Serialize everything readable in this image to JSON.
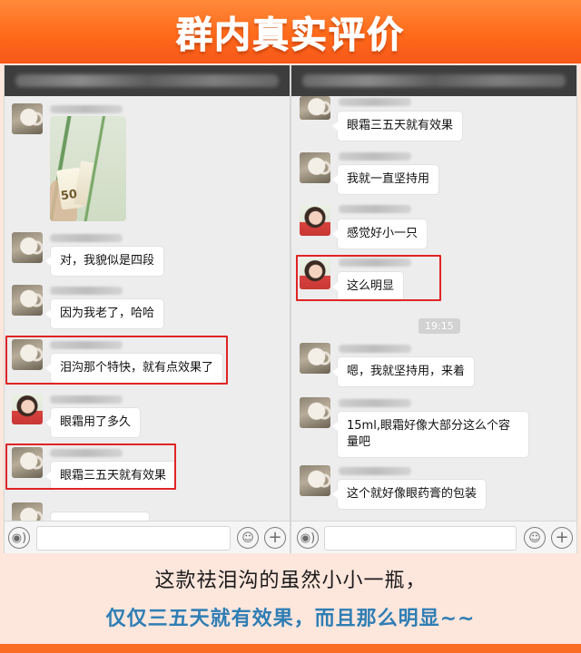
{
  "banner": {
    "title": "群内真实评价"
  },
  "left_chat": {
    "photo": {
      "label": "50"
    },
    "messages": [
      {
        "text": "对，我貌似是四段"
      },
      {
        "text": "因为我老了，哈哈"
      },
      {
        "text": "泪沟那个特快，就有点效果了"
      },
      {
        "text": "眼霜用了多久"
      },
      {
        "text": "眼霜三五天就有效果"
      }
    ]
  },
  "right_chat": {
    "messages": [
      {
        "text": "眼霜三五天就有效果"
      },
      {
        "text": "我就一直坚持用"
      },
      {
        "text": "感觉好小一只"
      },
      {
        "text": "这么明显"
      },
      {
        "text": "嗯，我就坚持用，来着"
      },
      {
        "text": "15ml,眼霜好像大部分这么个容量吧"
      },
      {
        "text": "这个就好像眼药膏的包装"
      }
    ],
    "timestamp": "19:15"
  },
  "input_bar": {
    "voice_icon": "voice-icon",
    "emoji_icon": "emoji-icon",
    "plus_icon": "plus-icon"
  },
  "caption": {
    "line1": "这款祛泪沟的虽然小小一瓶，",
    "line2": "仅仅三五天就有效果，而且那么明显~~"
  },
  "colors": {
    "banner": "#ff6a1a",
    "highlight_box": "#e02424",
    "caption_accent": "#2e7eb5",
    "background": "#fde6dc"
  }
}
